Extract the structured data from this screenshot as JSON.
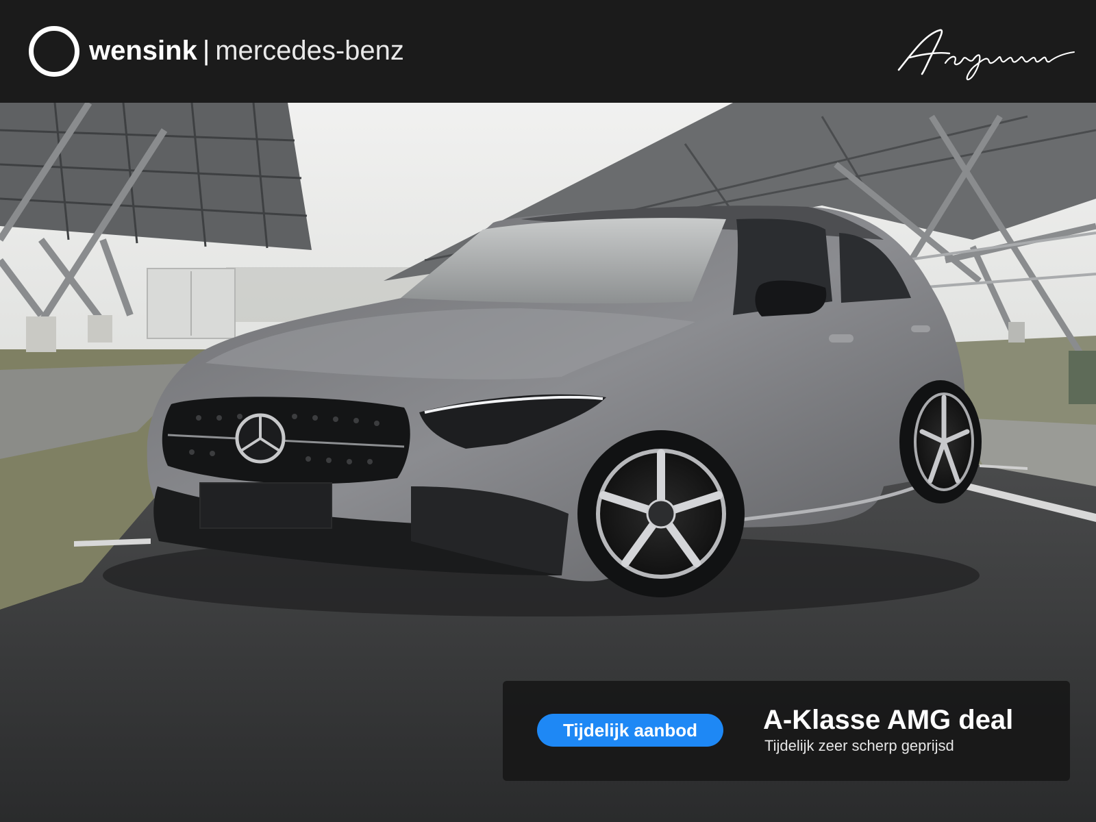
{
  "header": {
    "brand_main": "wensink",
    "brand_separator": "|",
    "brand_sub": "mercedes-benz",
    "signature": "Aangenaam",
    "background": "#1b1b1b"
  },
  "promo": {
    "badge": "Tijdelijk aanbod",
    "title": "A-Klasse AMG deal",
    "subtitle": "Tijdelijk zeer scherp geprijsd",
    "badge_color": "#1e88f5"
  }
}
